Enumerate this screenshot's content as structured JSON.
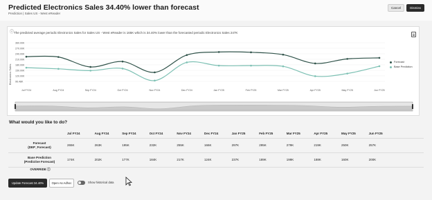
{
  "header": {
    "title": "Predicted Electronics Sales 34.40% lower than forecast",
    "subtitle": "Prediction | Sales US - West eReader",
    "cancel_label": "Cancel",
    "dismiss_label": "Dismiss"
  },
  "panel": {
    "info_text": "The predicted average periodic Electronics Sales for Sales US - West eReader is 165K which is 34.40% lower than the forecasted periodic Electronics Sales 247K"
  },
  "chart_data": {
    "type": "line",
    "categories": [
      "Jul FY24",
      "Aug FY24",
      "Sep FY24",
      "Oct FY24",
      "Nov FY24",
      "Dec FY24",
      "Jan FY25",
      "Feb FY25",
      "Mar FY25",
      "Apr FY25",
      "May FY25",
      "Jun FY25"
    ],
    "ylabel": "Electronics Sales",
    "yticks": [
      "360.00K",
      "270.00K",
      "240.00K",
      "210.00K",
      "180.00K",
      "150.00K",
      "120.00K",
      "96.48K"
    ],
    "ylim": [
      96.48,
      360
    ],
    "series": [
      {
        "name": "Forecast",
        "color": "#2f5249",
        "values": [
          265,
          263,
          195,
          232,
          158,
          276,
          297,
          295,
          279,
          219,
          250,
          257
        ]
      },
      {
        "name": "Base Prediction",
        "color": "#7cc0b3",
        "values": [
          190,
          182,
          170,
          184,
          102,
          226,
          204,
          204,
          199,
          132,
          150,
          200
        ]
      }
    ],
    "legend_position": "right"
  },
  "question": "What would you like to do?",
  "table": {
    "months": [
      "Jul FY24",
      "Aug FY24",
      "Sep FY24",
      "Oct FY24",
      "Nov FY24",
      "Dec FY24",
      "Jan FY25",
      "Feb FY25",
      "Mar FY25",
      "Apr FY25",
      "May FY25",
      "Jun FY25"
    ],
    "rows": [
      {
        "label_line1": "Forecast",
        "label_line2": "(DEP_Forecast)",
        "values": [
          "265K",
          "263K",
          "195K",
          "232K",
          "255K",
          "166K",
          "297K",
          "295K",
          "279K",
          "219K",
          "250K",
          "257K"
        ]
      },
      {
        "label_line1": "Base Prediction",
        "label_line2": "(Predictive Forecast)",
        "values": [
          "174K",
          "202K",
          "177K",
          "184K",
          "217K",
          "124K",
          "237K",
          "189K",
          "199K",
          "188K",
          "160K",
          "200K"
        ]
      }
    ],
    "override_label": "OVERRIDE"
  },
  "actions": {
    "update_label": "Update Forecast 34.40%",
    "open_label": "Open As Adhoc",
    "toggle_label": "Show historical data"
  }
}
